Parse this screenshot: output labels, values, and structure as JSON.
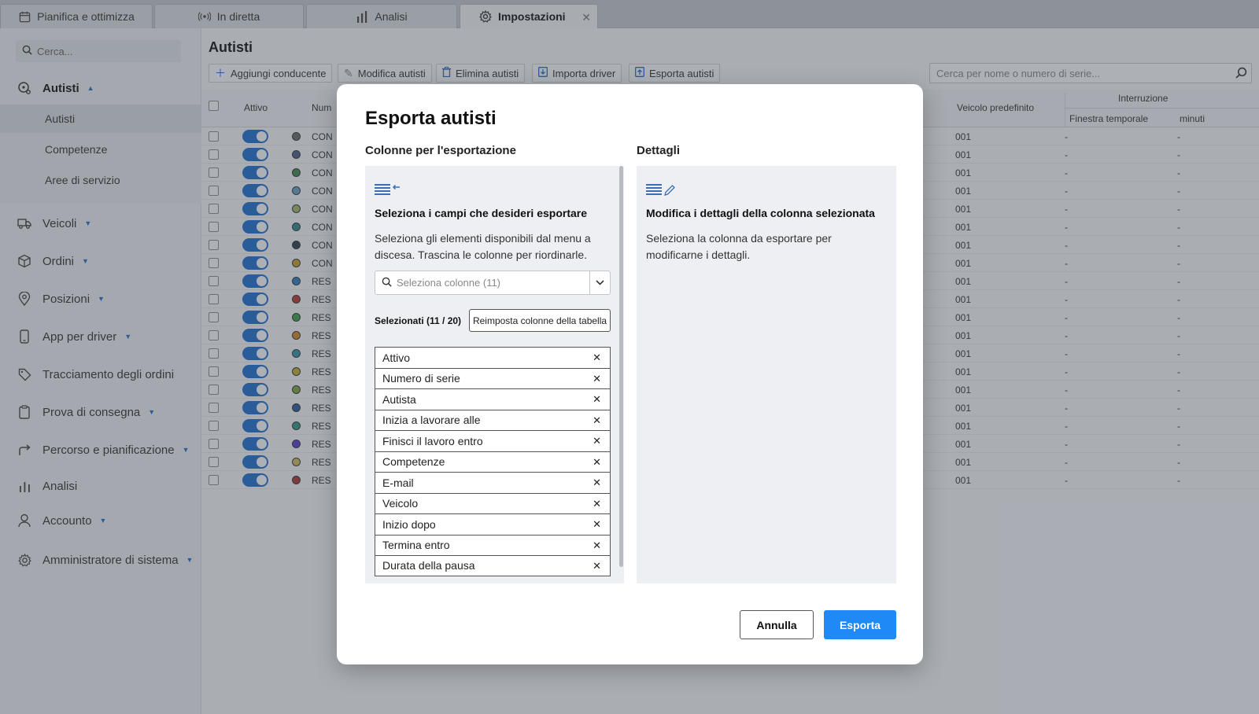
{
  "tabs": [
    {
      "label": "Pianifica e ottimizza",
      "icon": "calendar-icon"
    },
    {
      "label": "In diretta",
      "icon": "broadcast-icon"
    },
    {
      "label": "Analisi",
      "icon": "bar-chart-icon"
    },
    {
      "label": "Impostazioni",
      "icon": "gear-icon",
      "active": true
    }
  ],
  "sidebar": {
    "search_placeholder": "Cerca...",
    "items": [
      {
        "label": "Autisti",
        "icon": "drivers-icon"
      },
      {
        "label": "Veicoli",
        "icon": "truck-icon"
      },
      {
        "label": "Ordini",
        "icon": "box-icon"
      },
      {
        "label": "Posizioni",
        "icon": "location-pin-icon"
      },
      {
        "label": "App per driver",
        "icon": "phone-icon"
      },
      {
        "label": "Tracciamento degli ordini",
        "icon": "tag-icon"
      },
      {
        "label": "Prova di consegna",
        "icon": "clipboard-icon"
      },
      {
        "label": "Percorso e pianificazione",
        "icon": "route-arrow-icon"
      },
      {
        "label": "Analisi",
        "icon": "bar-chart-icon"
      },
      {
        "label": "Accounto",
        "icon": "user-icon"
      },
      {
        "label": "Amministratore di sistema",
        "icon": "gear-icon"
      }
    ],
    "sub_items": [
      "Autisti",
      "Competenze",
      "Aree di servizio"
    ]
  },
  "main": {
    "title": "Autisti",
    "toolbar": {
      "add": "Aggiungi conducente",
      "edit": "Modifica autisti",
      "delete": "Elimina autisti",
      "import": "Importa driver",
      "export": "Esporta autisti"
    },
    "search_placeholder": "Cerca per nome o numero di serie...",
    "table": {
      "col_active": "Attivo",
      "col_number": "Num",
      "col_vehicle": "Veicolo predefinito",
      "col_break": "Interruzione",
      "col_window": "Finestra temporale",
      "col_minutes": "minuti",
      "rows": [
        {
          "color": "#6e6a68",
          "num": "CON",
          "vehicle": "001",
          "window": "-",
          "minutes": "-"
        },
        {
          "color": "#4c5f86",
          "num": "CON",
          "vehicle": "001",
          "window": "-",
          "minutes": "-"
        },
        {
          "color": "#3f8a4f",
          "num": "CON",
          "vehicle": "001",
          "window": "-",
          "minutes": "-"
        },
        {
          "color": "#6aa0c8",
          "num": "CON",
          "vehicle": "001",
          "window": "-",
          "minutes": "-"
        },
        {
          "color": "#a6b86a",
          "num": "CON",
          "vehicle": "001",
          "window": "-",
          "minutes": "-"
        },
        {
          "color": "#2f8c8a",
          "num": "CON",
          "vehicle": "001",
          "window": "-",
          "minutes": "-"
        },
        {
          "color": "#2c3f4f",
          "num": "CON",
          "vehicle": "001",
          "window": "-",
          "minutes": "-"
        },
        {
          "color": "#c9a227",
          "num": "CON",
          "vehicle": "001",
          "window": "-",
          "minutes": "-"
        },
        {
          "color": "#2c7fc4",
          "num": "RES",
          "vehicle": "001",
          "window": "-",
          "minutes": "-"
        },
        {
          "color": "#c0392b",
          "num": "RES",
          "vehicle": "001",
          "window": "-",
          "minutes": "-"
        },
        {
          "color": "#3aa44a",
          "num": "RES",
          "vehicle": "001",
          "window": "-",
          "minutes": "-"
        },
        {
          "color": "#d98b1e",
          "num": "RES",
          "vehicle": "001",
          "window": "-",
          "minutes": "-"
        },
        {
          "color": "#3594b0",
          "num": "RES",
          "vehicle": "001",
          "window": "-",
          "minutes": "-"
        },
        {
          "color": "#c9b02a",
          "num": "RES",
          "vehicle": "001",
          "window": "-",
          "minutes": "-"
        },
        {
          "color": "#7fa83a",
          "num": "RES",
          "vehicle": "001",
          "window": "-",
          "minutes": "-"
        },
        {
          "color": "#2a5a9c",
          "num": "RES",
          "vehicle": "001",
          "window": "-",
          "minutes": "-"
        },
        {
          "color": "#2e9c88",
          "num": "RES",
          "vehicle": "001",
          "window": "-",
          "minutes": "-"
        },
        {
          "color": "#5b3dd6",
          "num": "RES",
          "vehicle": "001",
          "window": "-",
          "minutes": "-"
        },
        {
          "color": "#d4c15a",
          "num": "RES",
          "vehicle": "001",
          "window": "-",
          "minutes": "-"
        },
        {
          "color": "#b0342e",
          "num": "RES",
          "vehicle": "001",
          "window": "-",
          "minutes": "-"
        }
      ]
    }
  },
  "modal": {
    "title": "Esporta autisti",
    "left_heading": "Colonne per l'esportazione",
    "right_heading": "Dettagli",
    "left_panel": {
      "heading": "Seleziona i campi che desideri esportare",
      "description": "Seleziona gli elementi disponibili dal menu a discesa. Trascina le colonne per riordinarle.",
      "select_placeholder": "Seleziona colonne (11)",
      "selected_count": "Selezionati (11 / 20)",
      "reset_label": "Reimposta colonne della tabella",
      "fields": [
        "Attivo",
        "Numero di serie",
        "Autista",
        "Inizia a lavorare alle",
        "Finisci il lavoro entro",
        "Competenze",
        "E-mail",
        "Veicolo",
        "Inizio dopo",
        "Termina entro",
        "Durata della pausa"
      ]
    },
    "right_panel": {
      "heading": "Modifica i dettagli della colonna selezionata",
      "description": "Seleziona la colonna da esportare per modificarne i dettagli."
    },
    "cancel_label": "Annulla",
    "export_label": "Esporta"
  },
  "colors": {
    "accent": "#1f6fd1",
    "primary_button": "#1f8af5",
    "overlay": "rgba(60,66,78,0.42)"
  }
}
